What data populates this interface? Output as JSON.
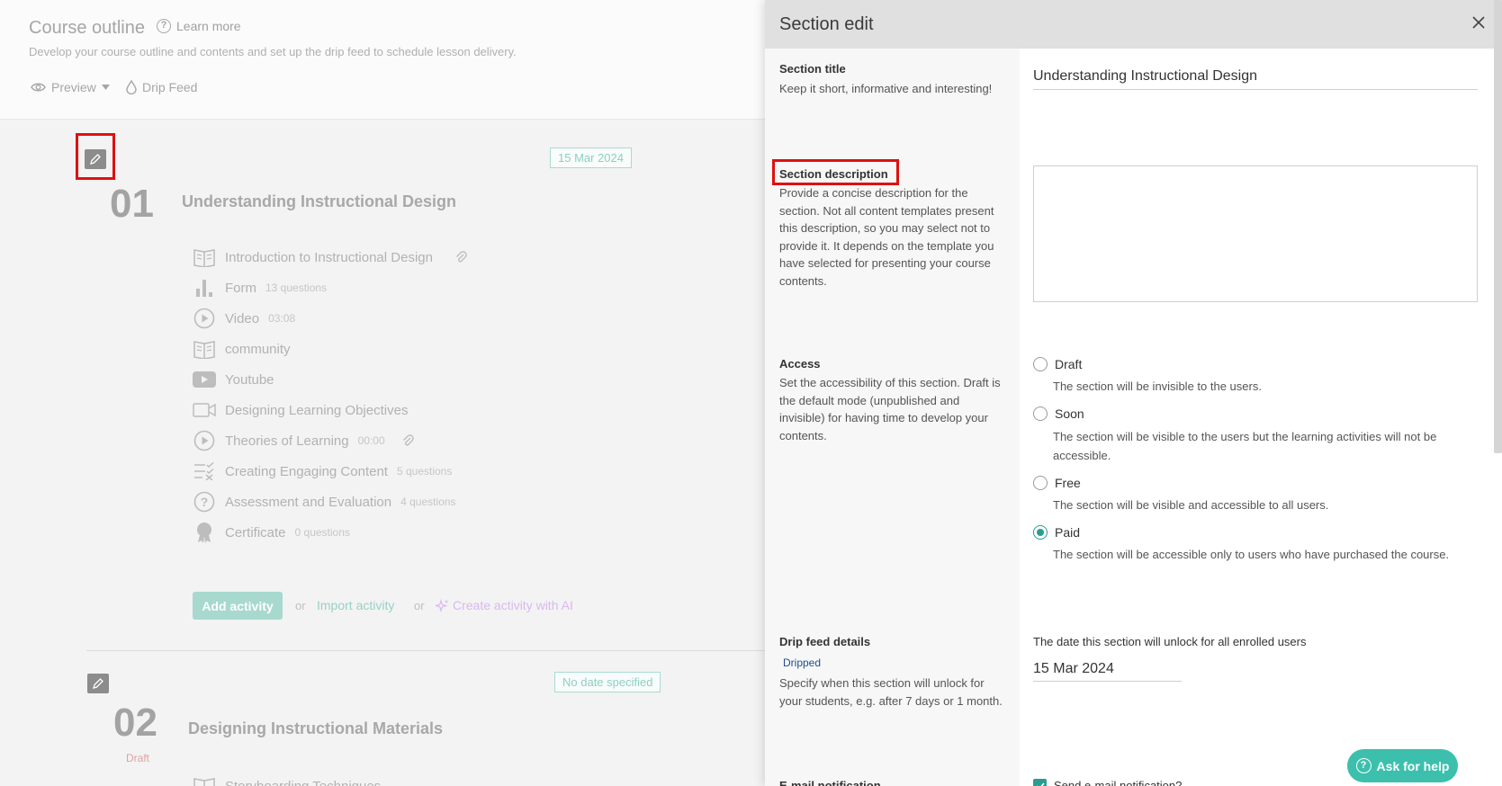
{
  "outline": {
    "title": "Course outline",
    "learn_more": "Learn more",
    "subtitle": "Develop your course outline and contents and set up the drip feed to schedule lesson delivery.",
    "preview_label": "Preview",
    "drip_feed_label": "Drip Feed"
  },
  "sections": [
    {
      "number": "01",
      "title": "Understanding Instructional Design",
      "date_badge": "15 Mar 2024",
      "activities": [
        {
          "icon": "book-icon",
          "label": "Introduction to Instructional Design",
          "meta": "",
          "attachment": true
        },
        {
          "icon": "bar-chart-icon",
          "label": "Form",
          "meta": "13 questions",
          "attachment": false
        },
        {
          "icon": "play-circle-icon",
          "label": "Video",
          "meta": "03:08",
          "attachment": false
        },
        {
          "icon": "book-icon",
          "label": "community",
          "meta": "",
          "attachment": false
        },
        {
          "icon": "youtube-icon",
          "label": "Youtube",
          "meta": "",
          "attachment": false
        },
        {
          "icon": "camera-icon",
          "label": "Designing Learning Objectives",
          "meta": "",
          "attachment": false
        },
        {
          "icon": "play-circle-icon",
          "label": "Theories of Learning",
          "meta": "00:00",
          "attachment": true
        },
        {
          "icon": "checklist-icon",
          "label": "Creating Engaging Content",
          "meta": "5 questions",
          "attachment": false
        },
        {
          "icon": "question-circle-icon",
          "label": "Assessment and Evaluation",
          "meta": "4 questions",
          "attachment": false
        },
        {
          "icon": "certificate-icon",
          "label": "Certificate",
          "meta": "0 questions",
          "attachment": false
        }
      ],
      "add_activity": "Add activity",
      "or": "or",
      "import_activity": "Import activity",
      "create_ai": "Create activity with AI"
    },
    {
      "number": "02",
      "title": "Designing Instructional Materials",
      "date_badge": "No date specified",
      "status": "Draft",
      "activities": [
        {
          "icon": "book-icon",
          "label": "Storyboarding Techniques",
          "meta": "",
          "attachment": false
        }
      ]
    }
  ],
  "panel": {
    "title": "Section edit",
    "section_title": {
      "label": "Section title",
      "help": "Keep it short, informative and interesting!",
      "value": "Understanding Instructional Design"
    },
    "section_description": {
      "label": "Section description",
      "help": "Provide a concise description for the section. Not all content templates present this description, so you may select not to provide it. It depends on the template you have selected for presenting your course contents.",
      "value": ""
    },
    "access": {
      "label": "Access",
      "help": "Set the accessibility of this section. Draft is the default mode (unpublished and invisible) for having time to develop your contents.",
      "options": [
        {
          "label": "Draft",
          "desc": "The section will be invisible to the users.",
          "checked": false
        },
        {
          "label": "Soon",
          "desc": "The section will be visible to the users but the learning activities will not be accessible.",
          "checked": false
        },
        {
          "label": "Free",
          "desc": "The section will be visible and accessible to all users.",
          "checked": false
        },
        {
          "label": "Paid",
          "desc": "The section will be accessible only to users who have purchased the course.",
          "checked": true
        }
      ]
    },
    "drip_feed": {
      "label": "Drip feed details",
      "tag": "Dripped",
      "help": "Specify when this section will unlock for your students, e.g. after 7 days or 1 month.",
      "date_label": "The date this section will unlock for all enrolled users",
      "date_value": "15 Mar 2024"
    },
    "email_notification": {
      "label": "E-mail notification",
      "checkbox_label": "Send e-mail notification?",
      "checked": true
    }
  },
  "help_button": "Ask for help",
  "colors": {
    "accent": "#2a9d8f",
    "help_button": "#3cc0ad",
    "highlight_outline": "#e01010",
    "dripped_tag": "#1d4f8f"
  }
}
